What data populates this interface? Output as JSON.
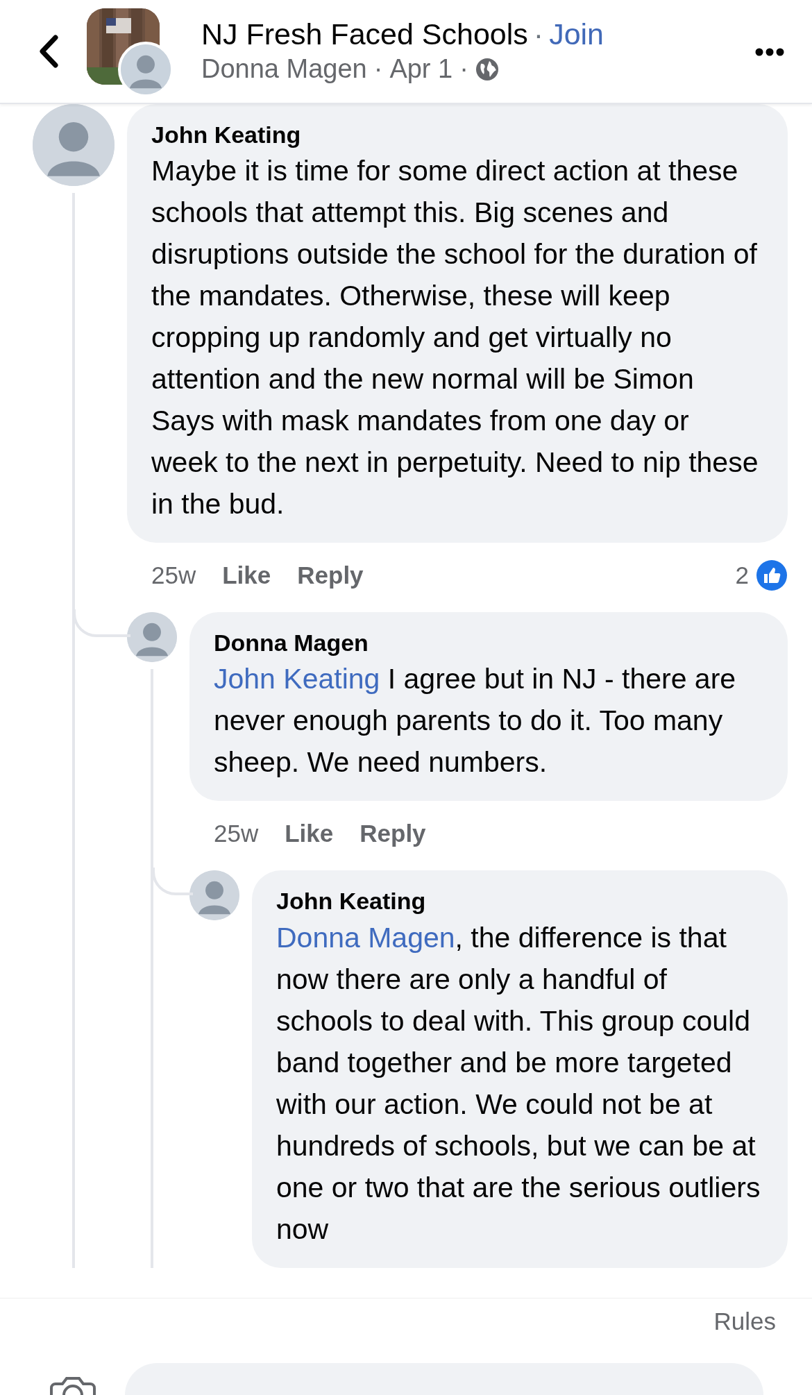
{
  "header": {
    "group_name": "NJ Fresh Faced Schools",
    "title_separator": "·",
    "join": "Join",
    "author": "Donna Magen",
    "meta_separator": "·",
    "date": "Apr 1",
    "date_separator": "·"
  },
  "comments": [
    {
      "author": "John Keating",
      "text": "Maybe it is time for some direct action at these schools that attempt this. Big scenes and disruptions outside the school for the duration of the mandates. Otherwise, these will keep cropping up randomly and get virtually no attention and the new normal will be Simon Says with mask mandates from one day or week to the next in perpetuity. Need to nip these in the bud.",
      "time": "25w",
      "actions": [
        "Like",
        "Reply"
      ],
      "reaction_count": "2",
      "replies": [
        {
          "author": "Donna Magen",
          "mention": "John Keating",
          "text": " I agree but in NJ - there are never enough parents to do it. Too many sheep. We need numbers.",
          "time": "25w",
          "actions": [
            "Like",
            "Reply"
          ],
          "replies": [
            {
              "author": "John Keating",
              "mention": "Donna Magen",
              "text": ", the difference is that now there are only a handful of schools to deal with. This group could band together and be more targeted with our action. We could not be at hundreds of schools, but we can be at one or two that are the serious outliers now"
            }
          ]
        }
      ]
    }
  ],
  "footer": {
    "rules": "Rules"
  }
}
